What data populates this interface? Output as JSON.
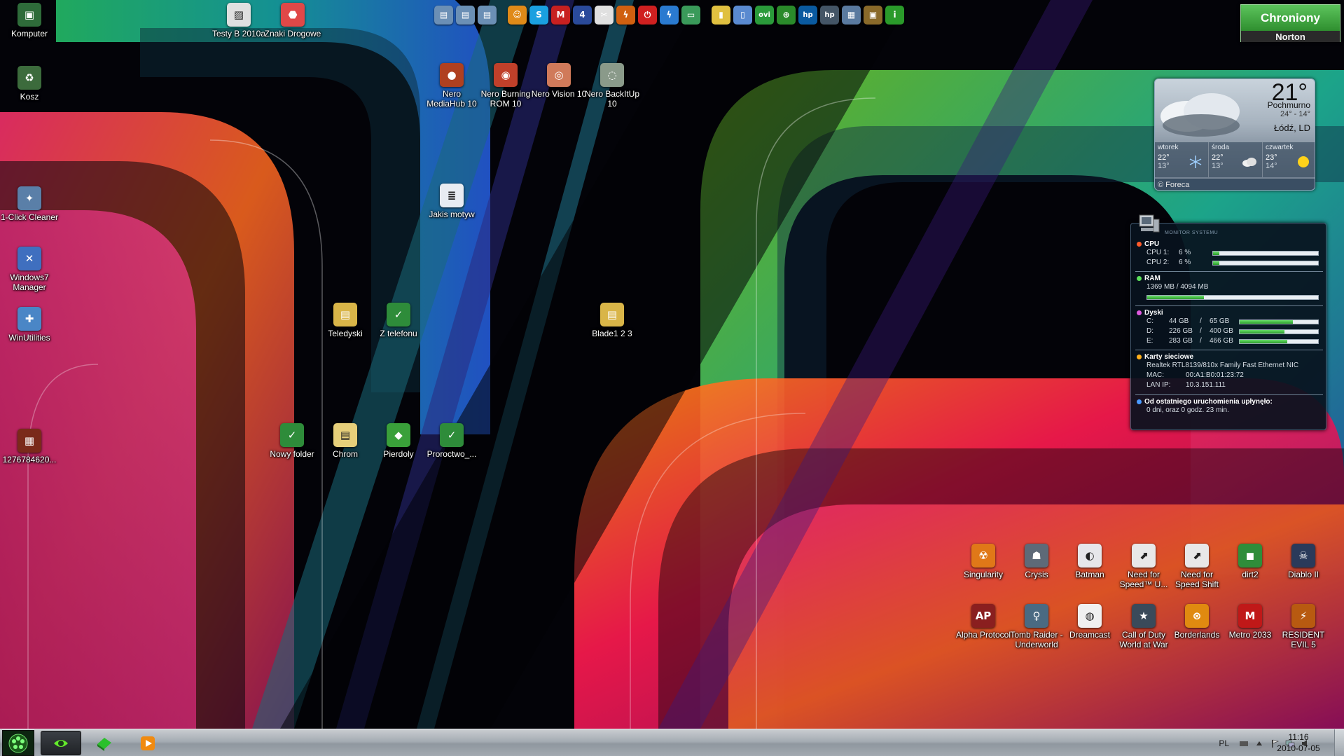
{
  "desktop_icons": [
    {
      "id": "komputer",
      "label": "Komputer",
      "icon": "computer-icon",
      "color": "#2e6b3a",
      "glyph": "▣"
    },
    {
      "id": "kosz",
      "label": "Kosz",
      "icon": "recycle-bin-icon",
      "color": "#3c6b3c",
      "glyph": "♻"
    },
    {
      "id": "cleaner",
      "label": "1-Click Cleaner",
      "icon": "cleaner-icon",
      "color": "#5a7fa8",
      "glyph": "✦"
    },
    {
      "id": "win7mgr",
      "label": "Windows7 Manager",
      "icon": "windows7-manager-icon",
      "color": "#3f6fbf",
      "glyph": "✕"
    },
    {
      "id": "winutils",
      "label": "WinUtilities",
      "icon": "winutilities-icon",
      "color": "#4a86c6",
      "glyph": "✚"
    },
    {
      "id": "img127",
      "label": "1276784620...",
      "icon": "image-file-icon",
      "color": "#7a2a1a",
      "glyph": "▦"
    },
    {
      "id": "testyb",
      "label": "Testy B 2010a",
      "icon": "testy-icon",
      "color": "#e0e0e0",
      "glyph": "▨"
    },
    {
      "id": "znaki",
      "label": "Znaki Drogowe",
      "icon": "road-signs-icon",
      "color": "#e04848",
      "glyph": "⬣"
    },
    {
      "id": "neromh",
      "label": "Nero MediaHub 10",
      "icon": "nero-mediahub-icon",
      "color": "#b04020",
      "glyph": "●"
    },
    {
      "id": "neroburn",
      "label": "Nero Burning ROM 10",
      "icon": "nero-burning-rom-icon",
      "color": "#c0402a",
      "glyph": "◉"
    },
    {
      "id": "nerovision",
      "label": "Nero Vision 10",
      "icon": "nero-vision-icon",
      "color": "#d07a5a",
      "glyph": "◎"
    },
    {
      "id": "nerobackit",
      "label": "Nero BackItUp 10",
      "icon": "nero-backitup-icon",
      "color": "#8a9a8a",
      "glyph": "◌"
    },
    {
      "id": "jakismotyw",
      "label": "Jakis motyw",
      "icon": "document-icon",
      "color": "#e8ecf2",
      "glyph": "≣"
    },
    {
      "id": "teledyski",
      "label": "Teledyski",
      "icon": "folder-icon",
      "color": "#d9b548",
      "glyph": "▤"
    },
    {
      "id": "ztelefonu",
      "label": "Z telefonu",
      "icon": "folder-green-icon",
      "color": "#2e8c3a",
      "glyph": "✓"
    },
    {
      "id": "blade",
      "label": "Blade1 2 3",
      "icon": "folder-icon",
      "color": "#d9b548",
      "glyph": "▤"
    },
    {
      "id": "nowyfolder",
      "label": "Nowy folder",
      "icon": "folder-green-icon",
      "color": "#2e8c3a",
      "glyph": "✓"
    },
    {
      "id": "chrom",
      "label": "Chrom",
      "icon": "folder-icon",
      "color": "#e6cf7a",
      "glyph": "▤"
    },
    {
      "id": "pierdoly",
      "label": "Pierdoly",
      "icon": "folder-green-icon",
      "color": "#3aa03a",
      "glyph": "◆"
    },
    {
      "id": "proroctwo",
      "label": "Proroctwo_...",
      "icon": "folder-green-icon",
      "color": "#2e8c3a",
      "glyph": "✓"
    },
    {
      "id": "singularity",
      "label": "Singularity",
      "icon": "singularity-icon",
      "color": "#e07818",
      "glyph": "☢"
    },
    {
      "id": "crysis",
      "label": "Crysis",
      "icon": "crysis-icon",
      "color": "#5e6a78",
      "glyph": "☗"
    },
    {
      "id": "batman",
      "label": "Batman",
      "icon": "batman-icon",
      "color": "#e6e6ea",
      "glyph": "◐"
    },
    {
      "id": "nfsu",
      "label": "Need for Speed™ U...",
      "icon": "need-for-speed-icon",
      "color": "#e8e8e8",
      "glyph": "⬈"
    },
    {
      "id": "nfsshift",
      "label": "Need for Speed Shift",
      "icon": "need-for-speed-shift-icon",
      "color": "#e8e8e8",
      "glyph": "⬈"
    },
    {
      "id": "dirt2",
      "label": "dirt2",
      "icon": "dirt2-icon",
      "color": "#2f8d3a",
      "glyph": "◼"
    },
    {
      "id": "diablo2",
      "label": "Diablo II",
      "icon": "diablo-icon",
      "color": "#2a3a5a",
      "glyph": "☠"
    },
    {
      "id": "alpha",
      "label": "Alpha Protocol",
      "icon": "alpha-protocol-icon",
      "color": "#8a1f1f",
      "glyph": "AP"
    },
    {
      "id": "tombraider",
      "label": "Tomb Raider - Underworld",
      "icon": "tomb-raider-icon",
      "color": "#4a6a82",
      "glyph": "♀"
    },
    {
      "id": "dreamcast",
      "label": "Dreamcast",
      "icon": "dreamcast-icon",
      "color": "#f0f0f0",
      "glyph": "◍"
    },
    {
      "id": "codwaw",
      "label": "Call of Duty World at War",
      "icon": "call-of-duty-icon",
      "color": "#3a4a5a",
      "glyph": "★"
    },
    {
      "id": "borderlands",
      "label": "Borderlands",
      "icon": "borderlands-icon",
      "color": "#e08a10",
      "glyph": "⊗"
    },
    {
      "id": "metro",
      "label": "Metro 2033",
      "icon": "metro-2033-icon",
      "color": "#c01818",
      "glyph": "M"
    },
    {
      "id": "re5",
      "label": "RESIDENT EVIL 5",
      "icon": "resident-evil-icon",
      "color": "#b85a10",
      "glyph": "⚡"
    }
  ],
  "quicklaunch": [
    {
      "icon": "folder-blue-icon",
      "color": "#6b8fb5",
      "glyph": "▤"
    },
    {
      "icon": "folder-blue-icon",
      "color": "#6b8fb5",
      "glyph": "▤"
    },
    {
      "icon": "folder-blue-icon",
      "color": "#6b8fb5",
      "glyph": "▤"
    },
    {
      "sep": true
    },
    {
      "icon": "smiley-icon",
      "color": "#e08a18",
      "glyph": "☺"
    },
    {
      "icon": "skype-icon",
      "color": "#1aa0e0",
      "glyph": "S"
    },
    {
      "icon": "gmail-icon",
      "color": "#c82020",
      "glyph": "M"
    },
    {
      "icon": "four-icon",
      "color": "#2a4a9a",
      "glyph": "4"
    },
    {
      "icon": "tool-icon",
      "color": "#e0e0e0",
      "glyph": "✂"
    },
    {
      "icon": "lightning-app-icon",
      "color": "#d06010",
      "glyph": "ϟ"
    },
    {
      "icon": "power-icon",
      "color": "#d02020",
      "glyph": "⏻"
    },
    {
      "icon": "flash-icon",
      "color": "#2a7ad0",
      "glyph": "ϟ"
    },
    {
      "icon": "monitor-icon",
      "color": "#3a9a5a",
      "glyph": "▭"
    },
    {
      "sep": true
    },
    {
      "icon": "chart-icon",
      "color": "#e0c040",
      "glyph": "▮"
    },
    {
      "icon": "phone-icon",
      "color": "#5a8ad0",
      "glyph": "▯"
    },
    {
      "icon": "ovi-icon",
      "color": "#2a9a3a",
      "glyph": "ovi"
    },
    {
      "icon": "green-globe-icon",
      "color": "#2a8a2a",
      "glyph": "⊕"
    },
    {
      "icon": "hp-icon",
      "color": "#0a5aa0",
      "glyph": "hp"
    },
    {
      "icon": "hp-logo-icon",
      "color": "#445566",
      "glyph": "hp"
    },
    {
      "icon": "photo-icon",
      "color": "#5a7aa0",
      "glyph": "▦"
    },
    {
      "icon": "box-icon",
      "color": "#8a6a2a",
      "glyph": "▣"
    },
    {
      "icon": "info-icon",
      "color": "#2a9a2a",
      "glyph": "i"
    }
  ],
  "norton": {
    "status": "Chroniony",
    "brand": "Norton"
  },
  "weather": {
    "temperature": "21°",
    "condition": "Pochmurno",
    "range": "24° - 14°",
    "city": "Łódź, LD",
    "forecast": [
      {
        "day": "wtorek",
        "high": "22°",
        "low": "13°",
        "icon": "snow-icon"
      },
      {
        "day": "środa",
        "high": "22°",
        "low": "13°",
        "icon": "cloud-icon"
      },
      {
        "day": "czwartek",
        "high": "23°",
        "low": "14°",
        "icon": "sun-icon"
      }
    ],
    "credit": "© Foreca"
  },
  "sysmon": {
    "header": "MONITOR SYSTEMU",
    "cpu": {
      "title": "CPU",
      "rows": [
        {
          "label": "CPU 1:",
          "value": "6 %",
          "pct": 0.06
        },
        {
          "label": "CPU 2:",
          "value": "6 %",
          "pct": 0.06
        }
      ]
    },
    "ram": {
      "title": "RAM",
      "value": "1369 MB / 4094 MB",
      "pct": 0.334
    },
    "disks": {
      "title": "Dyski",
      "rows": [
        {
          "label": "C:",
          "used": "44 GB",
          "total": "65 GB",
          "pct": 0.68
        },
        {
          "label": "D:",
          "used": "226 GB",
          "total": "400 GB",
          "pct": 0.57
        },
        {
          "label": "E:",
          "used": "283 GB",
          "total": "466 GB",
          "pct": 0.61
        }
      ]
    },
    "network": {
      "title": "Karty sieciowe",
      "adapter": "Realtek RTL8139/810x Family Fast Ethernet NIC",
      "mac_label": "MAC:",
      "mac": "00:A1:B0:01:23:72",
      "ip_label": "LAN IP:",
      "ip": "10.3.151.111"
    },
    "uptime": {
      "title": "Od ostatniego uruchomienia upłynęło:",
      "value": "0 dni, oraz 0 godz. 23 min."
    }
  },
  "taskbar": {
    "language": "PL",
    "time": "11:16",
    "date": "2010-07-05",
    "buttons": [
      {
        "icon": "nvidia-app-icon",
        "active": true
      },
      {
        "icon": "green-app-icon",
        "active": false
      },
      {
        "icon": "media-player-icon",
        "active": false
      }
    ]
  }
}
